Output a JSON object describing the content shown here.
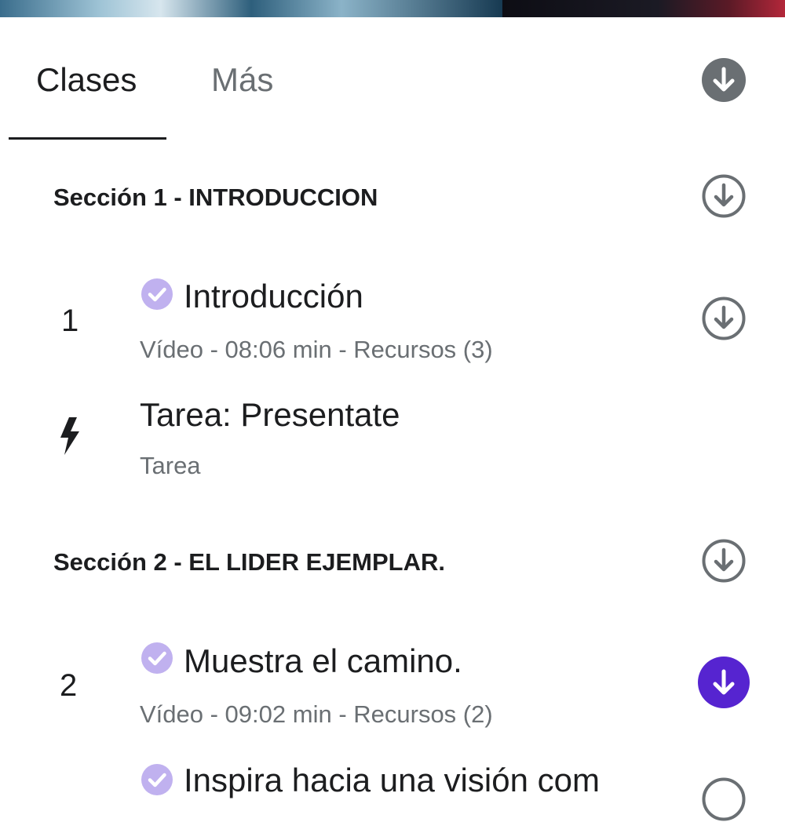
{
  "tabs": {
    "clases": "Clases",
    "mas": "Más"
  },
  "icons": {
    "download_all": "download-filled-icon",
    "download": "download-outline-icon",
    "download_active": "download-filled-icon",
    "completed": "check-circle-icon",
    "assignment": "lightning-icon"
  },
  "colors": {
    "accent": "#5624d0",
    "text": "#1c1d1f",
    "muted": "#6a6f73",
    "check": "#c0b1ef"
  },
  "sections": [
    {
      "title": "Sección 1 - INTRODUCCION",
      "lecture": {
        "number": "1",
        "title": "Introducción",
        "meta": "Vídeo - 08:06 min - Recursos (3)"
      },
      "task": {
        "title": "Tarea: Presentate",
        "meta": "Tarea"
      }
    },
    {
      "title": "Sección 2 - EL LIDER EJEMPLAR.",
      "lecture": {
        "number": "2",
        "title": "Muestra el camino.",
        "meta": "Vídeo - 09:02 min - Recursos (2)"
      },
      "next_title": "Inspira hacia una visión com"
    }
  ]
}
